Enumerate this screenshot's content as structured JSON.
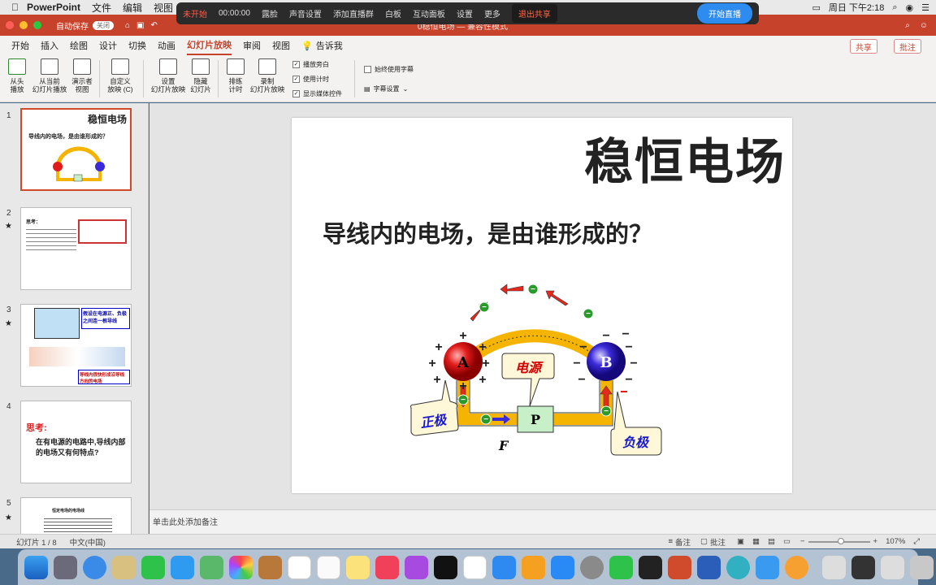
{
  "menubar": {
    "app": "PowerPoint",
    "items": [
      "文件",
      "编辑",
      "视图"
    ],
    "datetime": "周日 下午2:18"
  },
  "livebar": {
    "status": "未开始",
    "time": "00:00:00",
    "items": [
      "露脸",
      "声音设置",
      "添加直播群",
      "白板",
      "互动面板",
      "设置",
      "更多"
    ],
    "exit": "退出共享",
    "start": "开始直播"
  },
  "titlebar": {
    "autosave": "自动保存",
    "toggle": "关闭",
    "doc": "0稳恒电场 — 兼容性模式"
  },
  "tabs": [
    "开始",
    "插入",
    "绘图",
    "设计",
    "切换",
    "动画",
    "幻灯片放映",
    "审阅",
    "视图"
  ],
  "tell_me": "告诉我",
  "share": "共享",
  "comments": "批注",
  "ribbon": {
    "from_start": "从头\n播放",
    "from_current": "从当前\n幻灯片播放",
    "presenter": "演示者\n视图",
    "custom": "自定义\n放映 (C)",
    "setup": "设置\n幻灯片放映",
    "hide": "隐藏\n幻灯片",
    "rehearse": "排练\n计时",
    "record": "录制\n幻灯片放映",
    "chk_narration": "播放旁白",
    "chk_timing": "使用计时",
    "chk_media": "显示媒体控件",
    "chk_subtitles": "始终使用字幕",
    "subtitle_settings": "字幕设置"
  },
  "thumbs": [
    {
      "num": "1",
      "title": "稳恒电场",
      "line": "导线内的电场，是由谁形成的？"
    },
    {
      "num": "2",
      "text": "思考："
    },
    {
      "num": "3",
      "box1": "假设在电源正、负极之间连一根导线",
      "box2": "导线内很快形成沿导线方向的电场"
    },
    {
      "num": "4",
      "head": "思考:",
      "body": "在有电源的电路中,导线内部的电场又有何特点?"
    },
    {
      "num": "5",
      "text": "恒定电场的电场线"
    }
  ],
  "slide": {
    "title": "稳恒电场",
    "question": "导线内的电场，是由谁形成的？",
    "a": "A",
    "b": "B",
    "p": "P",
    "source": "电源",
    "positive": "正极",
    "negative": "负极",
    "f": "F",
    "plus": "+",
    "minus": "−"
  },
  "notes": "单击此处添加备注",
  "status": {
    "slide": "幻灯片 1 / 8",
    "lang": "中文(中国)",
    "notes": "备注",
    "comments": "批注",
    "zoom": "107%"
  },
  "colors": {
    "accent": "#c7422a",
    "wire": "#f5b400",
    "sphere_a": "#e11b1b",
    "sphere_b": "#3a2ad8"
  }
}
